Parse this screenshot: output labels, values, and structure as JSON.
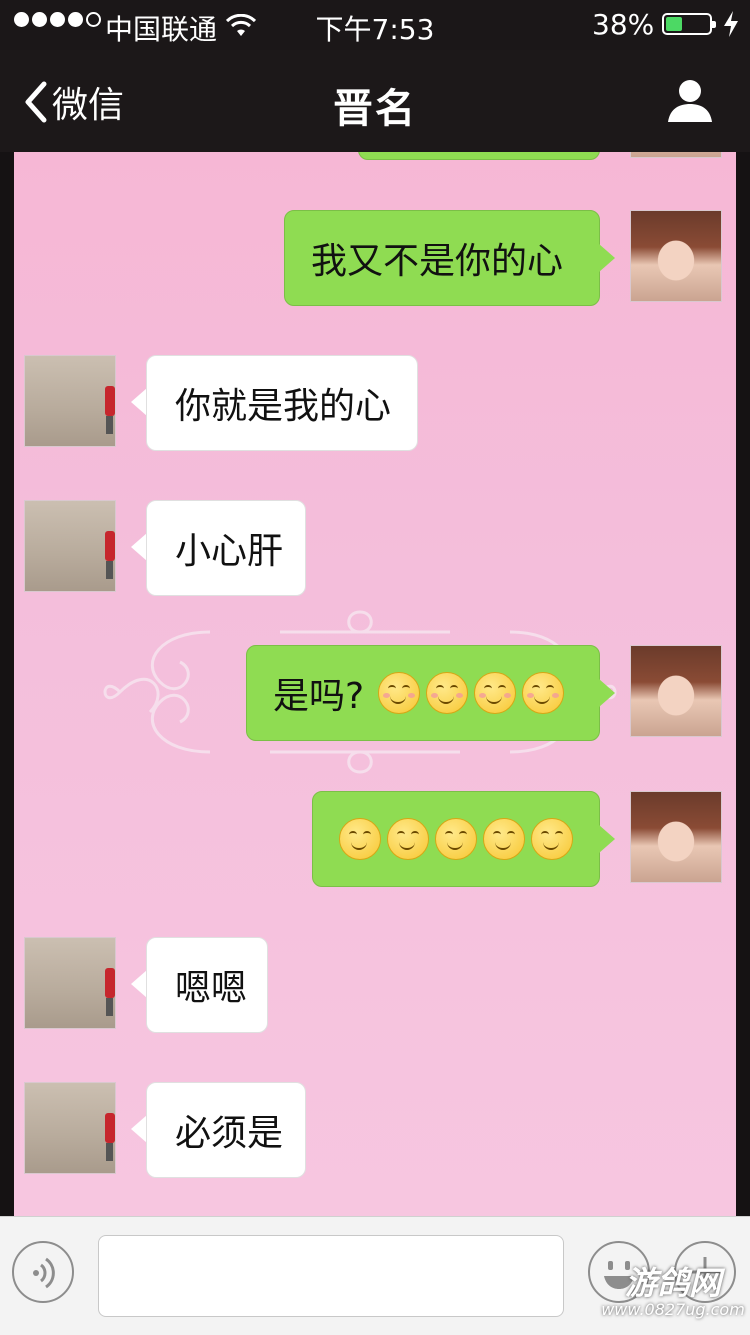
{
  "status_bar": {
    "carrier": "中国联通",
    "time": "下午7:53",
    "battery_percent": "38%",
    "battery_level": 0.38,
    "signal_bars_filled": 4,
    "signal_bars_total": 5
  },
  "nav": {
    "back_label": "微信",
    "title": "晋名",
    "profile_icon": "person-icon"
  },
  "messages": [
    {
      "side": "right",
      "text": "我又不是你的心",
      "emoji_count": 0
    },
    {
      "side": "left",
      "text": "你就是我的心",
      "emoji_count": 0
    },
    {
      "side": "left",
      "text": "小心肝",
      "emoji_count": 0
    },
    {
      "side": "right",
      "text": "是吗?",
      "emoji_count": 4,
      "emoji": "smile-emoji"
    },
    {
      "side": "right",
      "text": "",
      "emoji_count": 5,
      "emoji": "smile-emoji"
    },
    {
      "side": "left",
      "text": "嗯嗯",
      "emoji_count": 0
    },
    {
      "side": "left",
      "text": "必须是",
      "emoji_count": 0
    }
  ],
  "input_bar": {
    "voice_icon": "voice-icon",
    "emoji_icon": "emoji-icon",
    "plus_icon": "plus-icon",
    "text_value": ""
  },
  "watermark": {
    "logo_text": "游鸽网",
    "url": "www.0827ug.com"
  },
  "colors": {
    "chat_background": "#f6b7d5",
    "sent_bubble": "#8fdc52",
    "received_bubble": "#ffffff",
    "nav_background": "#1c1819"
  }
}
